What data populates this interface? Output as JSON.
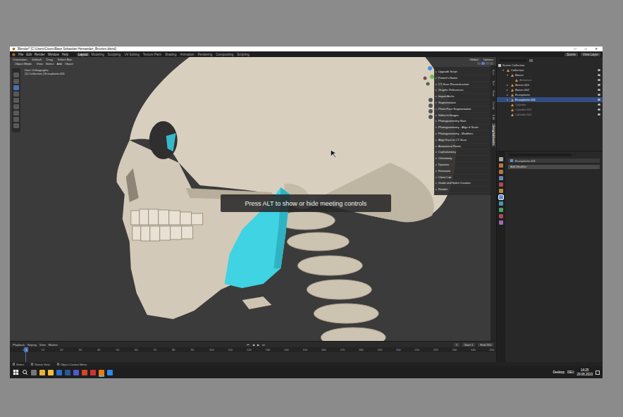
{
  "window": {
    "title": "Blender* [C:\\Users\\Cicero\\Base Sebastian Hernandez_Bruxism.blend]",
    "controls": [
      "—",
      "□",
      "✕"
    ]
  },
  "menu": [
    "File",
    "Edit",
    "Render",
    "Window",
    "Help"
  ],
  "workspaces": [
    {
      "label": "Layout",
      "selected": true
    },
    {
      "label": "Modeling",
      "selected": false
    },
    {
      "label": "Sculpting",
      "selected": false
    },
    {
      "label": "UV Editing",
      "selected": false
    },
    {
      "label": "Texture Paint",
      "selected": false
    },
    {
      "label": "Shading",
      "selected": false
    },
    {
      "label": "Animation",
      "selected": false
    },
    {
      "label": "Rendering",
      "selected": false
    },
    {
      "label": "Compositing",
      "selected": false
    },
    {
      "label": "Scripting",
      "selected": false
    }
  ],
  "scene": {
    "scene": "Scene",
    "view_layer": "View Layer"
  },
  "viewport": {
    "orientation_label": "Orientation",
    "orientation": "Default",
    "drag_label": "Drag",
    "drag": "Select Box",
    "mode": "Object Mode",
    "menus": [
      "View",
      "Select",
      "Add",
      "Object"
    ],
    "transform": "Global",
    "options": "Options",
    "view_label": "User Orthographic",
    "collection_label": "(1) Collection | Ecosplante.001"
  },
  "tools": [
    {
      "selected": false
    },
    {
      "selected": false
    },
    {
      "selected": true
    },
    {
      "selected": false
    },
    {
      "selected": false
    },
    {
      "selected": false
    },
    {
      "selected": false
    },
    {
      "selected": false
    },
    {
      "selected": false
    }
  ],
  "n_panel": {
    "arrow": "▸",
    "items": [
      "Upgrade Script",
      "Patient's Name",
      "CT-Scan Reconstruction",
      "Graphic References",
      "Import Archs",
      "Segmentation",
      "Photo Face Segmentation",
      "Video to Images",
      "Photogrammetry Start",
      "Photogrammetry - Align & Scale",
      "Photogrammetry - Modifiers",
      "Align Face to CT-Scan",
      "Anatomical Points",
      "Cephalometry",
      "Osteotomy",
      "Dynamic",
      "Kinematic",
      "Clone Lab",
      "Guide and Splint Creation",
      "Render"
    ],
    "tabs": [
      {
        "label": "Item",
        "selected": false
      },
      {
        "label": "Tool",
        "selected": false
      },
      {
        "label": "View",
        "selected": false
      },
      {
        "label": "Create",
        "selected": false
      },
      {
        "label": "Edit",
        "selected": false
      },
      {
        "label": "OrtogOnBlender",
        "selected": true
      }
    ]
  },
  "overlay": {
    "text": "Press ALT to show or hide meeting controls"
  },
  "outliner": {
    "header": "Scene Collection",
    "rows": [
      {
        "label": "Collection",
        "depth": 1,
        "arrow": "▾",
        "selected": false,
        "hidden": false
      },
      {
        "label": "Bones",
        "depth": 2,
        "arrow": "▾",
        "selected": false,
        "hidden": false
      },
      {
        "label": "Armature",
        "depth": 3,
        "arrow": "",
        "selected": false,
        "hidden": true
      },
      {
        "label": "Bones.001",
        "depth": 2,
        "arrow": "▸",
        "selected": false,
        "hidden": false
      },
      {
        "label": "Bones.002",
        "depth": 2,
        "arrow": "▸",
        "selected": false,
        "hidden": false
      },
      {
        "label": "Ecosplante",
        "depth": 2,
        "arrow": "▸",
        "selected": false,
        "hidden": false
      },
      {
        "label": "Ecosplante.001",
        "depth": 2,
        "arrow": "▸",
        "selected": true,
        "hidden": false
      },
      {
        "label": "Cylinder",
        "depth": 2,
        "arrow": "",
        "selected": false,
        "hidden": true
      },
      {
        "label": "Cylinder.001",
        "depth": 2,
        "arrow": "",
        "selected": false,
        "hidden": true
      },
      {
        "label": "Cylinder.002",
        "depth": 2,
        "arrow": "",
        "selected": false,
        "hidden": true
      }
    ]
  },
  "property_tabs": [
    {
      "selected": false,
      "color": "#c8c8c8"
    },
    {
      "selected": false,
      "color": "#d98c4a"
    },
    {
      "selected": false,
      "color": "#d98c4a"
    },
    {
      "selected": false,
      "color": "#7a9fd6"
    },
    {
      "selected": false,
      "color": "#c75a5a"
    },
    {
      "selected": false,
      "color": "#d9a54a"
    },
    {
      "selected": true,
      "color": "#5a8fd6"
    },
    {
      "selected": false,
      "color": "#5ab0d6"
    },
    {
      "selected": false,
      "color": "#5ac07a"
    },
    {
      "selected": false,
      "color": "#c75a5a"
    },
    {
      "selected": false,
      "color": "#c07ad6"
    }
  ],
  "properties": {
    "object": "Ecosplante.001",
    "button": "Add Modifier"
  },
  "timeline": {
    "menus": [
      "Playback",
      "Keying",
      "View",
      "Marker"
    ],
    "transport": [
      "⏮",
      "◀",
      "▶",
      "⏭"
    ],
    "current": "1",
    "start_label": "Start",
    "start": "1",
    "end_label": "End",
    "end": "250",
    "ticks": [
      "0",
      "10",
      "20",
      "30",
      "40",
      "50",
      "60",
      "70",
      "80",
      "90",
      "100",
      "110",
      "120",
      "130",
      "140",
      "150",
      "160",
      "170",
      "180",
      "190",
      "200",
      "210",
      "220",
      "230",
      "240",
      "250"
    ]
  },
  "status_bar": [
    "Select",
    "Rotate View",
    "Object Context Menu"
  ],
  "taskbar": {
    "desktop": "Desktop",
    "language": "DEU",
    "time": "14:25",
    "date": "29.06.2023"
  }
}
